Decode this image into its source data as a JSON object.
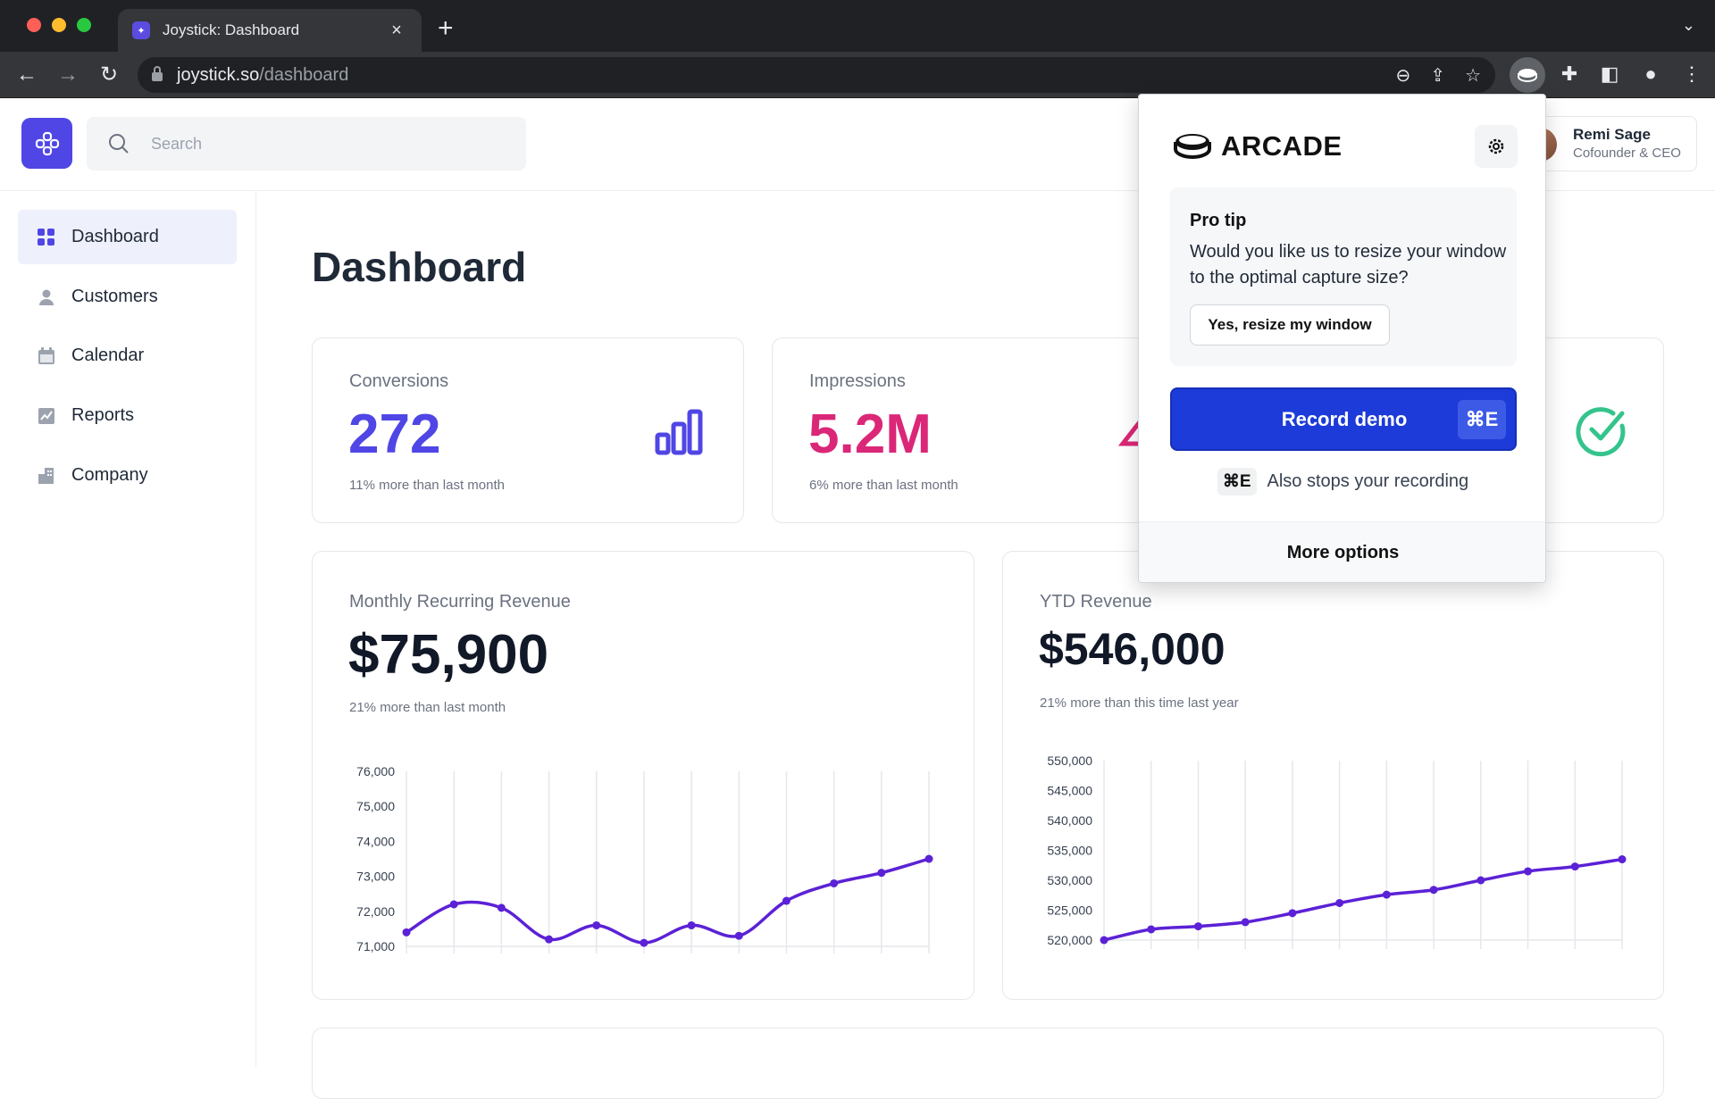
{
  "browser": {
    "tab_title": "Joystick: Dashboard",
    "url_host": "joystick.so",
    "url_path": "/dashboard"
  },
  "header": {
    "search_placeholder": "Search",
    "user_name": "Remi Sage",
    "user_role": "Cofounder & CEO"
  },
  "sidebar": {
    "items": [
      {
        "label": "Dashboard",
        "icon": "grid-icon",
        "active": true
      },
      {
        "label": "Customers",
        "icon": "user-icon",
        "active": false
      },
      {
        "label": "Calendar",
        "icon": "calendar-icon",
        "active": false
      },
      {
        "label": "Reports",
        "icon": "chart-image-icon",
        "active": false
      },
      {
        "label": "Company",
        "icon": "building-icon",
        "active": false
      }
    ]
  },
  "main": {
    "title": "Dashboard",
    "stats": [
      {
        "label": "Conversions",
        "value": "272",
        "sub": "11% more than last month",
        "color": "#4f46e5",
        "icon": "bar-chart-icon"
      },
      {
        "label": "Impressions",
        "value": "5.2M",
        "sub": "6% more than last month",
        "color": "#db2777",
        "icon": "number-four-icon"
      }
    ],
    "mrr": {
      "label": "Monthly Recurring Revenue",
      "value": "$75,900",
      "sub": "21% more than last month"
    },
    "ytd": {
      "label": "YTD Revenue",
      "value": "$546,000",
      "sub": "21% more than this time last year"
    }
  },
  "chart_data": [
    {
      "type": "line",
      "x": [
        1,
        2,
        3,
        4,
        5,
        6,
        7,
        8,
        9,
        10,
        11,
        12
      ],
      "series": [
        {
          "values": [
            71400,
            72200,
            72100,
            71200,
            71600,
            71100,
            71600,
            71300,
            72300,
            72800,
            73100,
            73500
          ]
        }
      ],
      "yticks": [
        "76,000",
        "75,000",
        "74,000",
        "73,000",
        "72,000",
        "71,000"
      ],
      "ylim": [
        71000,
        76000
      ],
      "color": "#5b21d6",
      "grid": "vertical"
    },
    {
      "type": "line",
      "x": [
        1,
        2,
        3,
        4,
        5,
        6,
        7,
        8,
        9,
        10,
        11,
        12
      ],
      "series": [
        {
          "values": [
            520000,
            521800,
            522300,
            523000,
            524500,
            526200,
            527600,
            528400,
            530000,
            531500,
            532300,
            533500
          ]
        }
      ],
      "yticks": [
        "550,000",
        "545,000",
        "540,000",
        "535,000",
        "530,000",
        "525,000",
        "520,000"
      ],
      "ylim": [
        520000,
        550000
      ],
      "color": "#5b21d6",
      "grid": "vertical"
    }
  ],
  "arcade": {
    "brand": "ARCADE",
    "tip_title": "Pro tip",
    "tip_text": "Would you like us to resize your window to the optimal capture size?",
    "resize_label": "Yes, resize my window",
    "record_label": "Record demo",
    "record_shortcut": "⌘E",
    "stop_shortcut": "⌘E",
    "stop_text": "Also stops your recording",
    "more_options": "More options"
  }
}
